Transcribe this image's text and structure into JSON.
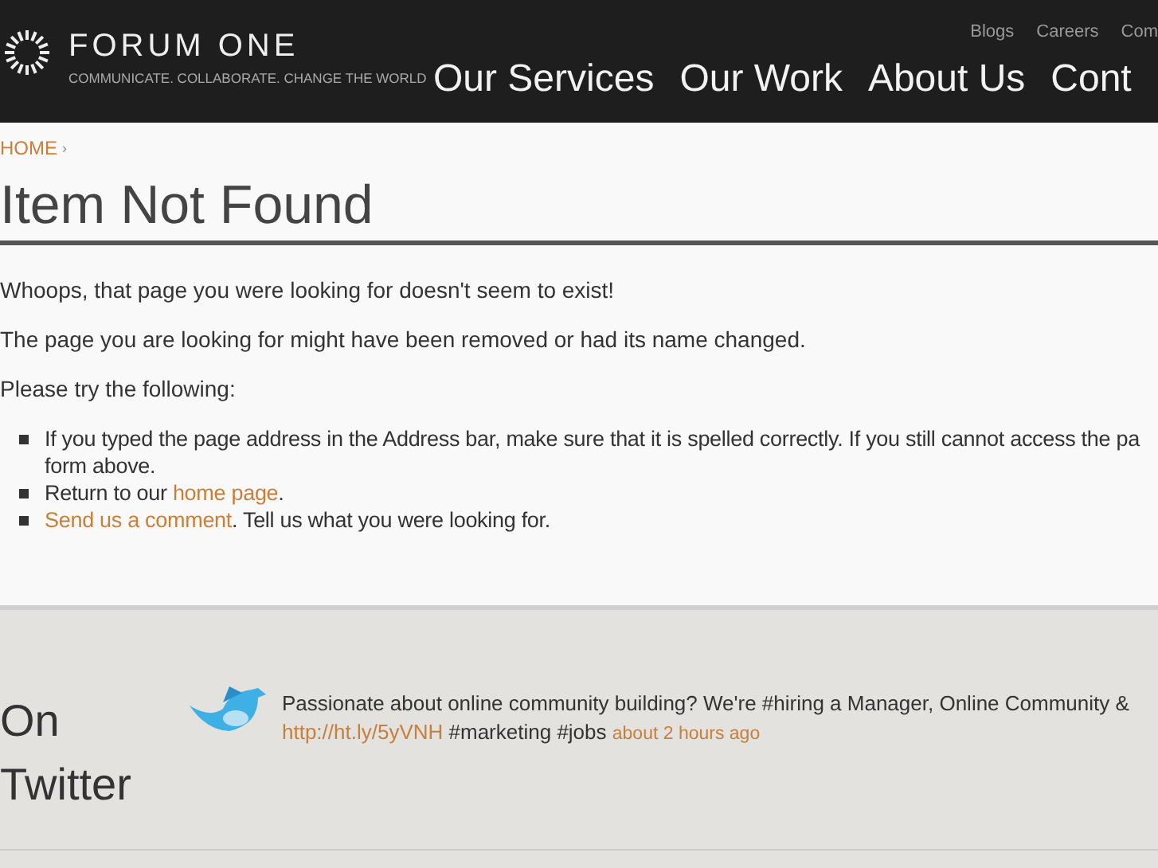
{
  "header": {
    "logo_text": "FORUM ONE",
    "tagline": "COMMUNICATE. COLLABORATE. CHANGE THE WORLD",
    "top_links": [
      "Blogs",
      "Careers",
      "Com"
    ],
    "nav": [
      "Our Services",
      "Our Work",
      "About Us",
      "Cont"
    ]
  },
  "breadcrumb": {
    "link": "HOME",
    "separator": "›"
  },
  "title": "Item Not Found",
  "paragraphs": [
    "Whoops, that page you were looking for doesn't seem to exist!",
    "The page you are looking for might have been removed or had its name changed.",
    "Please try the following:"
  ],
  "suggestions": [
    {
      "kind": "text",
      "lines": [
        "If you typed the page address in the Address bar, make sure that it is spelled correctly. If you still cannot access the pa",
        "form above."
      ]
    },
    {
      "kind": "link_after",
      "before": "Return to our ",
      "link": "home page",
      "after": "."
    },
    {
      "kind": "link_first",
      "link": "Send us a comment",
      "after": ". Tell us what you were looking for."
    }
  ],
  "twitter": {
    "heading_lines": [
      "On",
      "Twitter"
    ],
    "tweet": {
      "line_1": "Passionate about online community building? We're #hiring a Manager, Online Community &",
      "link": "http://ht.ly/5yVNH",
      "tags": " #marketing #jobs ",
      "time": "about 2 hours ago"
    }
  }
}
